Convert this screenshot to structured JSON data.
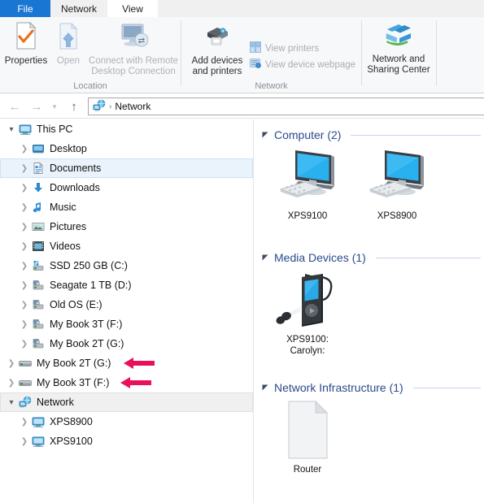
{
  "window": {
    "tabs": [
      {
        "label": "File",
        "active_style": "file"
      },
      {
        "label": "Network",
        "active_style": "inactive"
      },
      {
        "label": "View",
        "active_style": "selected"
      }
    ]
  },
  "ribbon": {
    "groups": [
      {
        "name": "location",
        "label": "Location"
      },
      {
        "name": "network",
        "label": "Network"
      }
    ],
    "buttons": [
      {
        "name": "properties",
        "label": "Properties",
        "icon": "properties-icon",
        "enabled": true
      },
      {
        "name": "open",
        "label": "Open",
        "icon": "open-icon",
        "enabled": false
      },
      {
        "name": "connect_rdc",
        "label": "Connect with Remote Desktop Connection",
        "icon": "remote-desktop-icon",
        "enabled": false
      },
      {
        "name": "add_devices",
        "label": "Add devices and printers",
        "icon": "printer-icon",
        "enabled": true
      },
      {
        "name": "view_printers",
        "label": "View printers",
        "icon": "view-printers-icon",
        "enabled": false
      },
      {
        "name": "view_device_webpage",
        "label": "View device webpage",
        "icon": "view-webpage-icon",
        "enabled": false
      },
      {
        "name": "network_sharing_center",
        "label": "Network and Sharing Center",
        "icon": "windows-network-icon",
        "enabled": true
      }
    ]
  },
  "addressbar": {
    "back_tooltip": "Back",
    "forward_tooltip": "Forward",
    "recent_tooltip": "Recent locations",
    "up_tooltip": "Up",
    "icon": "network-globe-icon",
    "separator": "›",
    "path": "Network"
  },
  "tree": {
    "items": [
      {
        "label": "This PC",
        "indent": 0,
        "chevron": "open",
        "icon": "monitor-icon",
        "state": "normal"
      },
      {
        "label": "Desktop",
        "indent": 1,
        "chevron": "closed",
        "icon": "desktop-icon",
        "state": "normal"
      },
      {
        "label": "Documents",
        "indent": 1,
        "chevron": "closed",
        "icon": "documents-icon",
        "state": "selected"
      },
      {
        "label": "Downloads",
        "indent": 1,
        "chevron": "closed",
        "icon": "downloads-icon",
        "state": "normal"
      },
      {
        "label": "Music",
        "indent": 1,
        "chevron": "closed",
        "icon": "music-icon",
        "state": "normal"
      },
      {
        "label": "Pictures",
        "indent": 1,
        "chevron": "closed",
        "icon": "pictures-icon",
        "state": "normal"
      },
      {
        "label": "Videos",
        "indent": 1,
        "chevron": "closed",
        "icon": "videos-icon",
        "state": "normal"
      },
      {
        "label": "SSD 250 GB (C:)",
        "indent": 1,
        "chevron": "closed",
        "icon": "ssd-drive-icon",
        "state": "normal"
      },
      {
        "label": "Seagate 1 TB (D:)",
        "indent": 1,
        "chevron": "closed",
        "icon": "network-drive-icon",
        "state": "normal"
      },
      {
        "label": "Old OS (E:)",
        "indent": 1,
        "chevron": "closed",
        "icon": "network-drive-icon",
        "state": "normal"
      },
      {
        "label": "My Book 3T (F:)",
        "indent": 1,
        "chevron": "closed",
        "icon": "network-drive-icon",
        "state": "normal"
      },
      {
        "label": "My Book 2T (G:)",
        "indent": 1,
        "chevron": "closed",
        "icon": "network-drive-icon",
        "state": "normal"
      },
      {
        "label": "My Book 2T (G:)",
        "indent": 0,
        "chevron": "closed",
        "icon": "hard-drive-icon",
        "state": "normal",
        "annotation": "red-arrow"
      },
      {
        "label": "My Book 3T (F:)",
        "indent": 0,
        "chevron": "closed",
        "icon": "hard-drive-icon",
        "state": "normal",
        "annotation": "red-arrow"
      },
      {
        "label": "Network",
        "indent": 0,
        "chevron": "open",
        "icon": "network-globe-icon",
        "state": "grayselected"
      },
      {
        "label": "XPS8900",
        "indent": 1,
        "chevron": "closed",
        "icon": "monitor-icon",
        "state": "normal"
      },
      {
        "label": "XPS9100",
        "indent": 1,
        "chevron": "closed",
        "icon": "monitor-icon",
        "state": "normal"
      }
    ]
  },
  "content": {
    "groups": [
      {
        "name": "computer",
        "title": "Computer (2)",
        "items": [
          {
            "name": "XPS9100",
            "icon": "computer-tile-icon"
          },
          {
            "name": "XPS8900",
            "icon": "computer-tile-icon"
          }
        ]
      },
      {
        "name": "media-devices",
        "title": "Media Devices (1)",
        "items": [
          {
            "name": "XPS9100: Carolyn:",
            "icon": "media-player-tile-icon"
          }
        ]
      },
      {
        "name": "network-infrastructure",
        "title": "Network Infrastructure (1)",
        "items": [
          {
            "name": "Router",
            "icon": "generic-file-tile-icon"
          }
        ]
      }
    ]
  },
  "colors": {
    "tab_active": "#1976d2",
    "selection_blue": "#eaf3fc",
    "group_header": "#2b4a8b",
    "annotation_arrow": "#e8115b"
  }
}
